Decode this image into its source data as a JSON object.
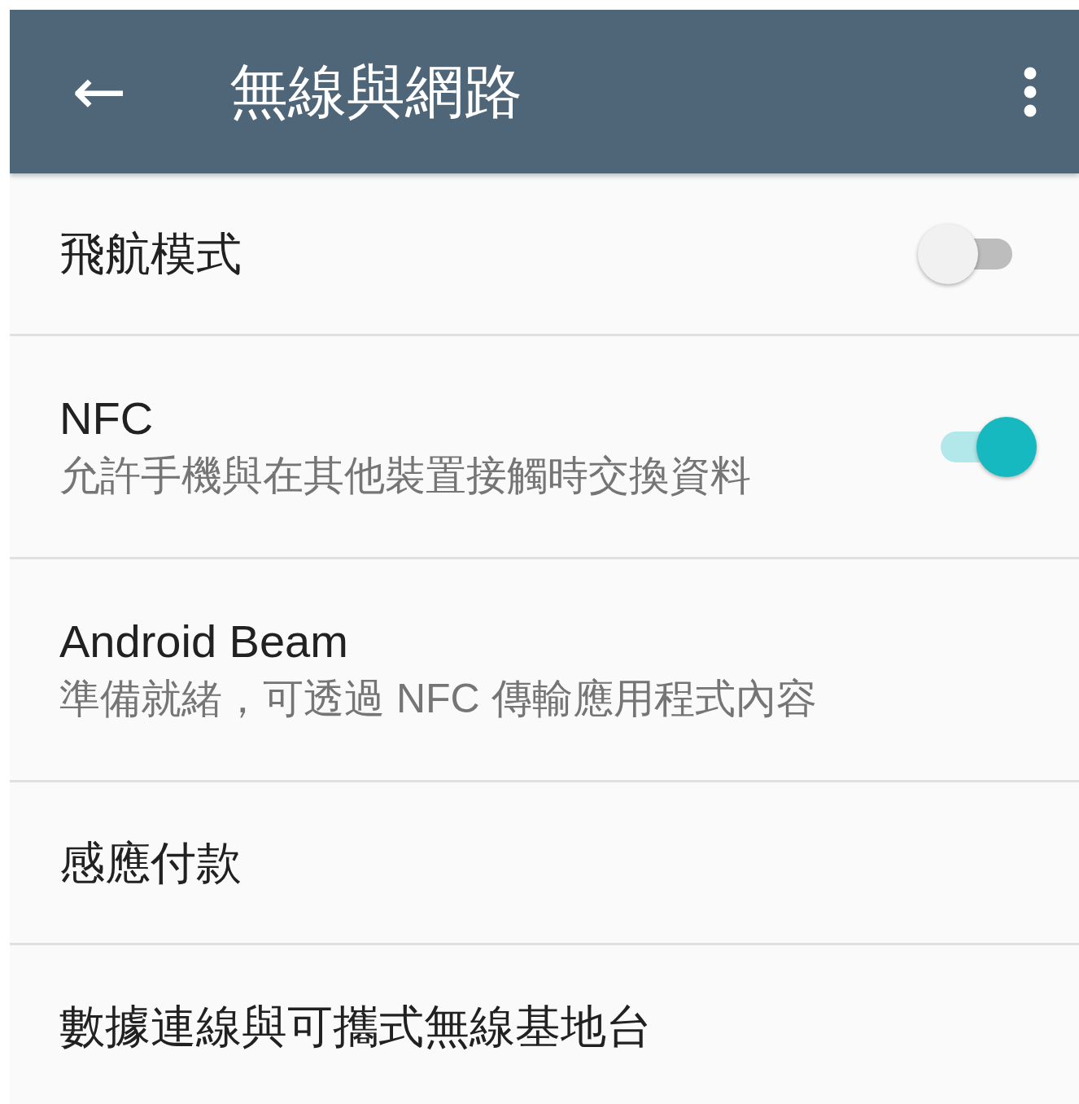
{
  "app_bar": {
    "back_icon": "←",
    "title": "無線與網路"
  },
  "items": [
    {
      "kind": "toggle",
      "title": "飛航模式",
      "on": false
    },
    {
      "kind": "toggle",
      "title": "NFC",
      "subtitle": "允許手機與在其他裝置接觸時交換資料",
      "on": true
    },
    {
      "kind": "plain",
      "title": "Android Beam",
      "subtitle": "準備就緒，可透過 NFC 傳輸應用程式內容"
    },
    {
      "kind": "plain",
      "title": "感應付款"
    },
    {
      "kind": "plain",
      "title": "數據連線與可攜式無線基地台"
    }
  ]
}
